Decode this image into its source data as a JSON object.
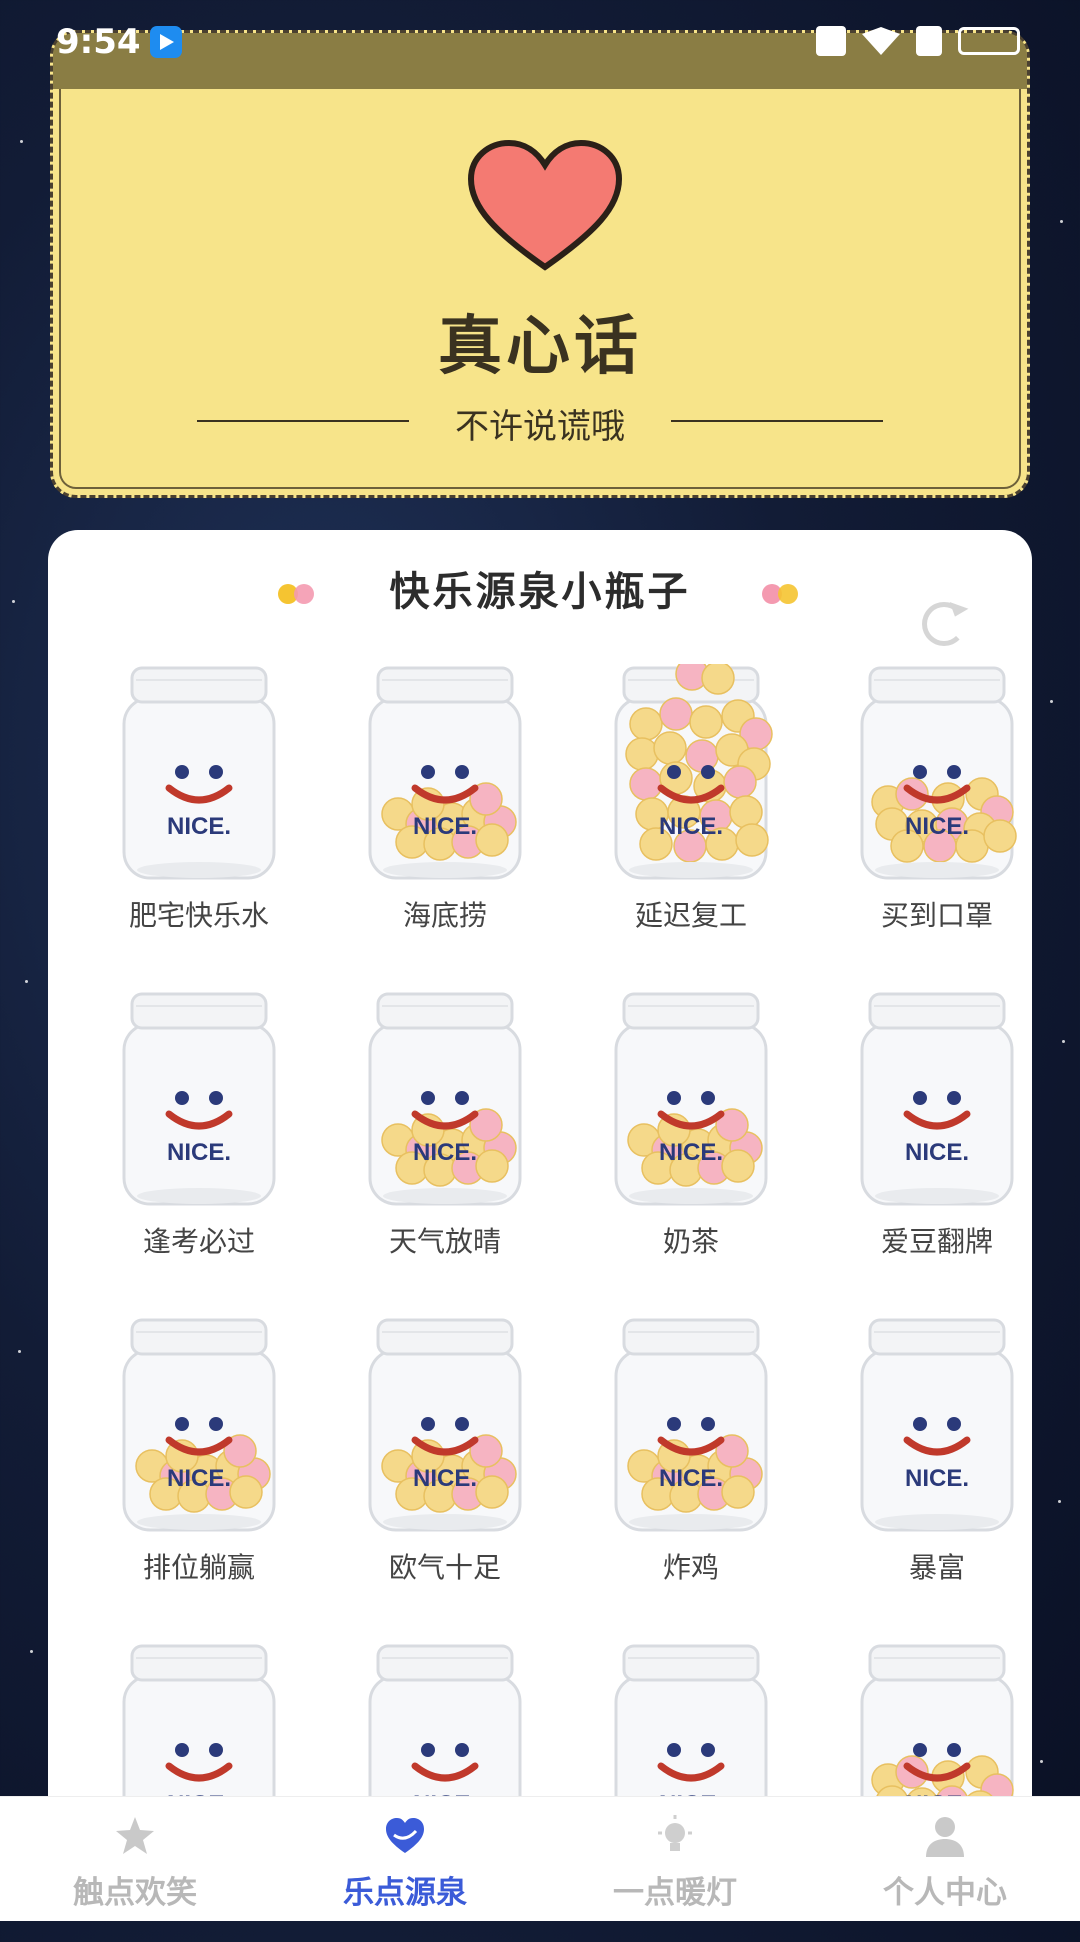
{
  "status_bar": {
    "time": "9:54"
  },
  "truth_card": {
    "title": "真心话",
    "subtitle": "不许说谎哦",
    "heart_color": "#f47a72",
    "background": "#f7e48a"
  },
  "panel": {
    "title": "快乐源泉小瓶子",
    "dot_colors": [
      "#f5c431",
      "#f49ab0"
    ]
  },
  "jars": [
    {
      "label": "肥宅快乐水",
      "fill": "empty"
    },
    {
      "label": "海底捞",
      "fill": "low"
    },
    {
      "label": "延迟复工",
      "fill": "full"
    },
    {
      "label": "买到口罩",
      "fill": "half"
    },
    {
      "label": "逢考必过",
      "fill": "empty"
    },
    {
      "label": "天气放晴",
      "fill": "low"
    },
    {
      "label": "奶茶",
      "fill": "low"
    },
    {
      "label": "爱豆翻牌",
      "fill": "empty"
    },
    {
      "label": "排位躺赢",
      "fill": "low"
    },
    {
      "label": "欧气十足",
      "fill": "low"
    },
    {
      "label": "炸鸡",
      "fill": "low"
    },
    {
      "label": "暴富",
      "fill": "empty"
    },
    {
      "label": "",
      "fill": "empty"
    },
    {
      "label": "",
      "fill": "empty"
    },
    {
      "label": "",
      "fill": "empty"
    },
    {
      "label": "",
      "fill": "half"
    }
  ],
  "jar_text": "NICE.",
  "tabs": [
    {
      "label": "触点欢笑",
      "icon": "star-icon",
      "active": false
    },
    {
      "label": "乐点源泉",
      "icon": "heart-hand-icon",
      "active": true
    },
    {
      "label": "一点暖灯",
      "icon": "lamp-icon",
      "active": false
    },
    {
      "label": "个人中心",
      "icon": "person-icon",
      "active": false
    }
  ],
  "colors": {
    "active_tab": "#3b5bd8",
    "inactive_tab": "#b8b8b8"
  }
}
